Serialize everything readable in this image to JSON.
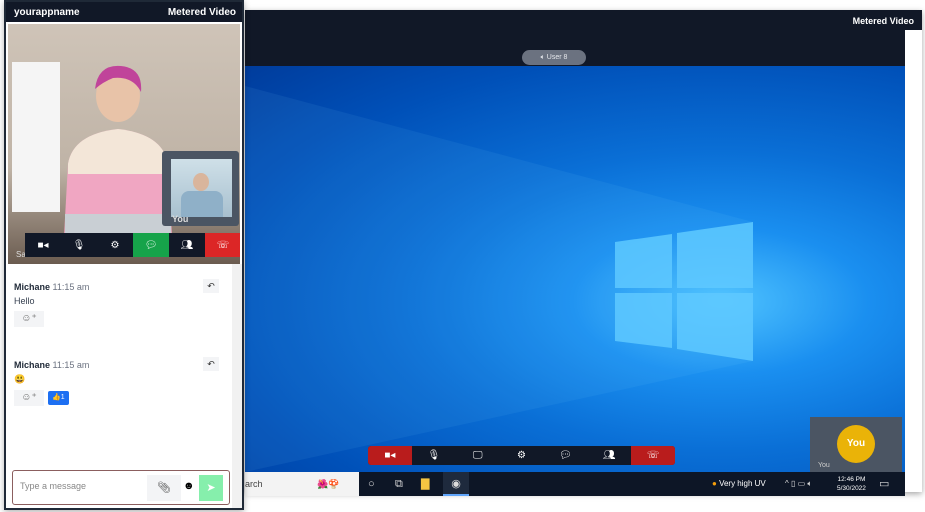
{
  "left_panel": {
    "app_name": "yourappname",
    "brand": "Metered Video",
    "main_participant_name": "Sam",
    "pip_label": "You",
    "controls": [
      {
        "icon": "camera-icon",
        "color": "#111827"
      },
      {
        "icon": "microphone-icon",
        "color": "#111827"
      },
      {
        "icon": "gear-icon",
        "color": "#111827"
      },
      {
        "icon": "chat-icon",
        "color": "#16a34a"
      },
      {
        "icon": "participants-icon",
        "color": "#111827"
      },
      {
        "icon": "hangup-icon",
        "color": "#dc2626"
      }
    ],
    "messages": [
      {
        "author": "Michane",
        "time": "11:15 am",
        "text": "Hello",
        "reactions": []
      },
      {
        "author": "Michane",
        "time": "11:15 am",
        "text": "😃",
        "reactions": [
          {
            "emoji": "👍",
            "count": "1"
          }
        ]
      }
    ],
    "composer": {
      "placeholder": "Type a message"
    }
  },
  "right_panel": {
    "brand": "Metered Video",
    "presenter_pill": "User 8",
    "taskbar": {
      "search_text": "arch",
      "weather": "Very high UV",
      "time": "12:46 PM",
      "date": "5/30/2022"
    },
    "you_tile": {
      "avatar": "You",
      "label": "You",
      "avatar_color": "#eab308"
    },
    "controls": [
      {
        "icon": "camera-off-icon",
        "color": "#b91c1c"
      },
      {
        "icon": "microphone-icon",
        "color": "#111827"
      },
      {
        "icon": "screen-share-icon",
        "color": "#111827"
      },
      {
        "icon": "gear-icon",
        "color": "#111827"
      },
      {
        "icon": "chat-icon",
        "color": "#111827"
      },
      {
        "icon": "participants-icon",
        "color": "#111827"
      },
      {
        "icon": "hangup-icon",
        "color": "#b91c1c"
      }
    ]
  }
}
